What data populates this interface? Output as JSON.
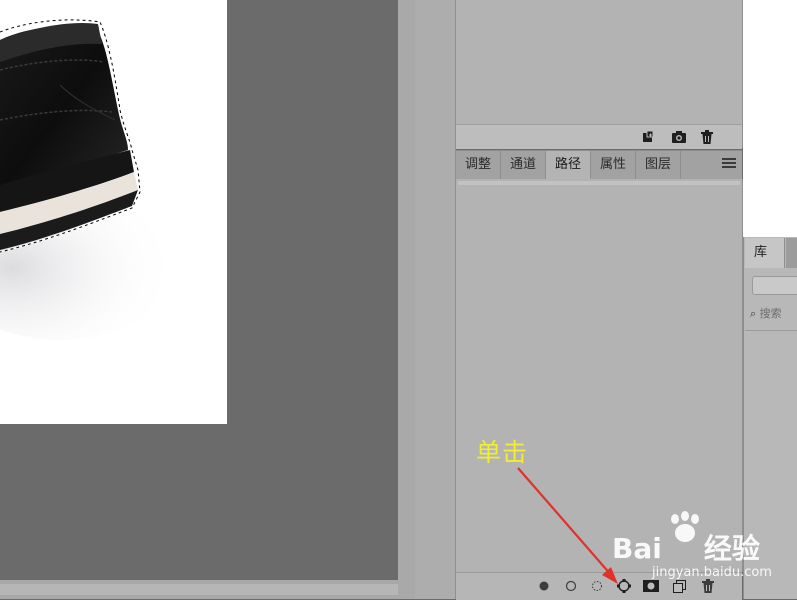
{
  "panel_tabs": [
    {
      "label": "调整",
      "active": false
    },
    {
      "label": "通道",
      "active": false
    },
    {
      "label": "路径",
      "active": true
    },
    {
      "label": "属性",
      "active": false
    },
    {
      "label": "图层",
      "active": false
    }
  ],
  "library": {
    "tab_label": "库",
    "search_placeholder": "搜索"
  },
  "annotation": {
    "text": "单击",
    "color": "#f1ee30",
    "arrow_color": "#e0322c"
  },
  "watermark": {
    "brand": "Bai",
    "brand_suffix": "经验",
    "site": "jingyan.baidu.com"
  },
  "icons": {
    "upper_footer": [
      "new-snapshot-icon",
      "camera-icon",
      "trash-icon"
    ],
    "paths_footer": [
      "fill-path-icon",
      "stroke-path-icon",
      "load-selection-icon",
      "make-work-path-icon",
      "add-mask-icon",
      "new-path-icon",
      "delete-path-icon"
    ],
    "panel_menu": "hamburger-menu-icon"
  },
  "colors": {
    "canvas_bg": "#6b6b6b",
    "panel_bg": "#b3b3b3",
    "document_bg": "#ffffff"
  }
}
